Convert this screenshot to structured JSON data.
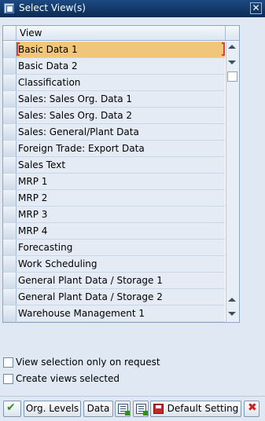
{
  "window": {
    "title": "Select View(s)"
  },
  "table": {
    "column_header": "View",
    "rows": [
      {
        "label": "Basic Data 1",
        "selected": true
      },
      {
        "label": "Basic Data 2"
      },
      {
        "label": "Classification"
      },
      {
        "label": "Sales: Sales Org. Data 1"
      },
      {
        "label": "Sales: Sales Org. Data 2"
      },
      {
        "label": "Sales: General/Plant Data"
      },
      {
        "label": "Foreign Trade: Export Data"
      },
      {
        "label": "Sales Text"
      },
      {
        "label": "MRP 1"
      },
      {
        "label": "MRP 2"
      },
      {
        "label": "MRP 3"
      },
      {
        "label": "MRP 4"
      },
      {
        "label": "Forecasting"
      },
      {
        "label": "Work Scheduling"
      },
      {
        "label": "General Plant Data / Storage 1"
      },
      {
        "label": "General Plant Data / Storage 2"
      },
      {
        "label": "Warehouse Management 1"
      }
    ]
  },
  "options": {
    "view_on_request": "View selection only on request",
    "create_selected": "Create views selected"
  },
  "toolbar": {
    "org_levels": "Org. Levels",
    "data": "Data",
    "default_setting": "Default Setting"
  },
  "icons": {
    "confirm": "check-icon",
    "cancel": "cancel-icon",
    "select_all": "select-all-icon",
    "deselect_all": "deselect-all-icon",
    "save": "save-icon"
  },
  "colors": {
    "title_bar": "#0b2b55",
    "selected_row": "#f0c77a",
    "row_bg": "#e4ebf4",
    "focus_border": "#e53d2a"
  }
}
